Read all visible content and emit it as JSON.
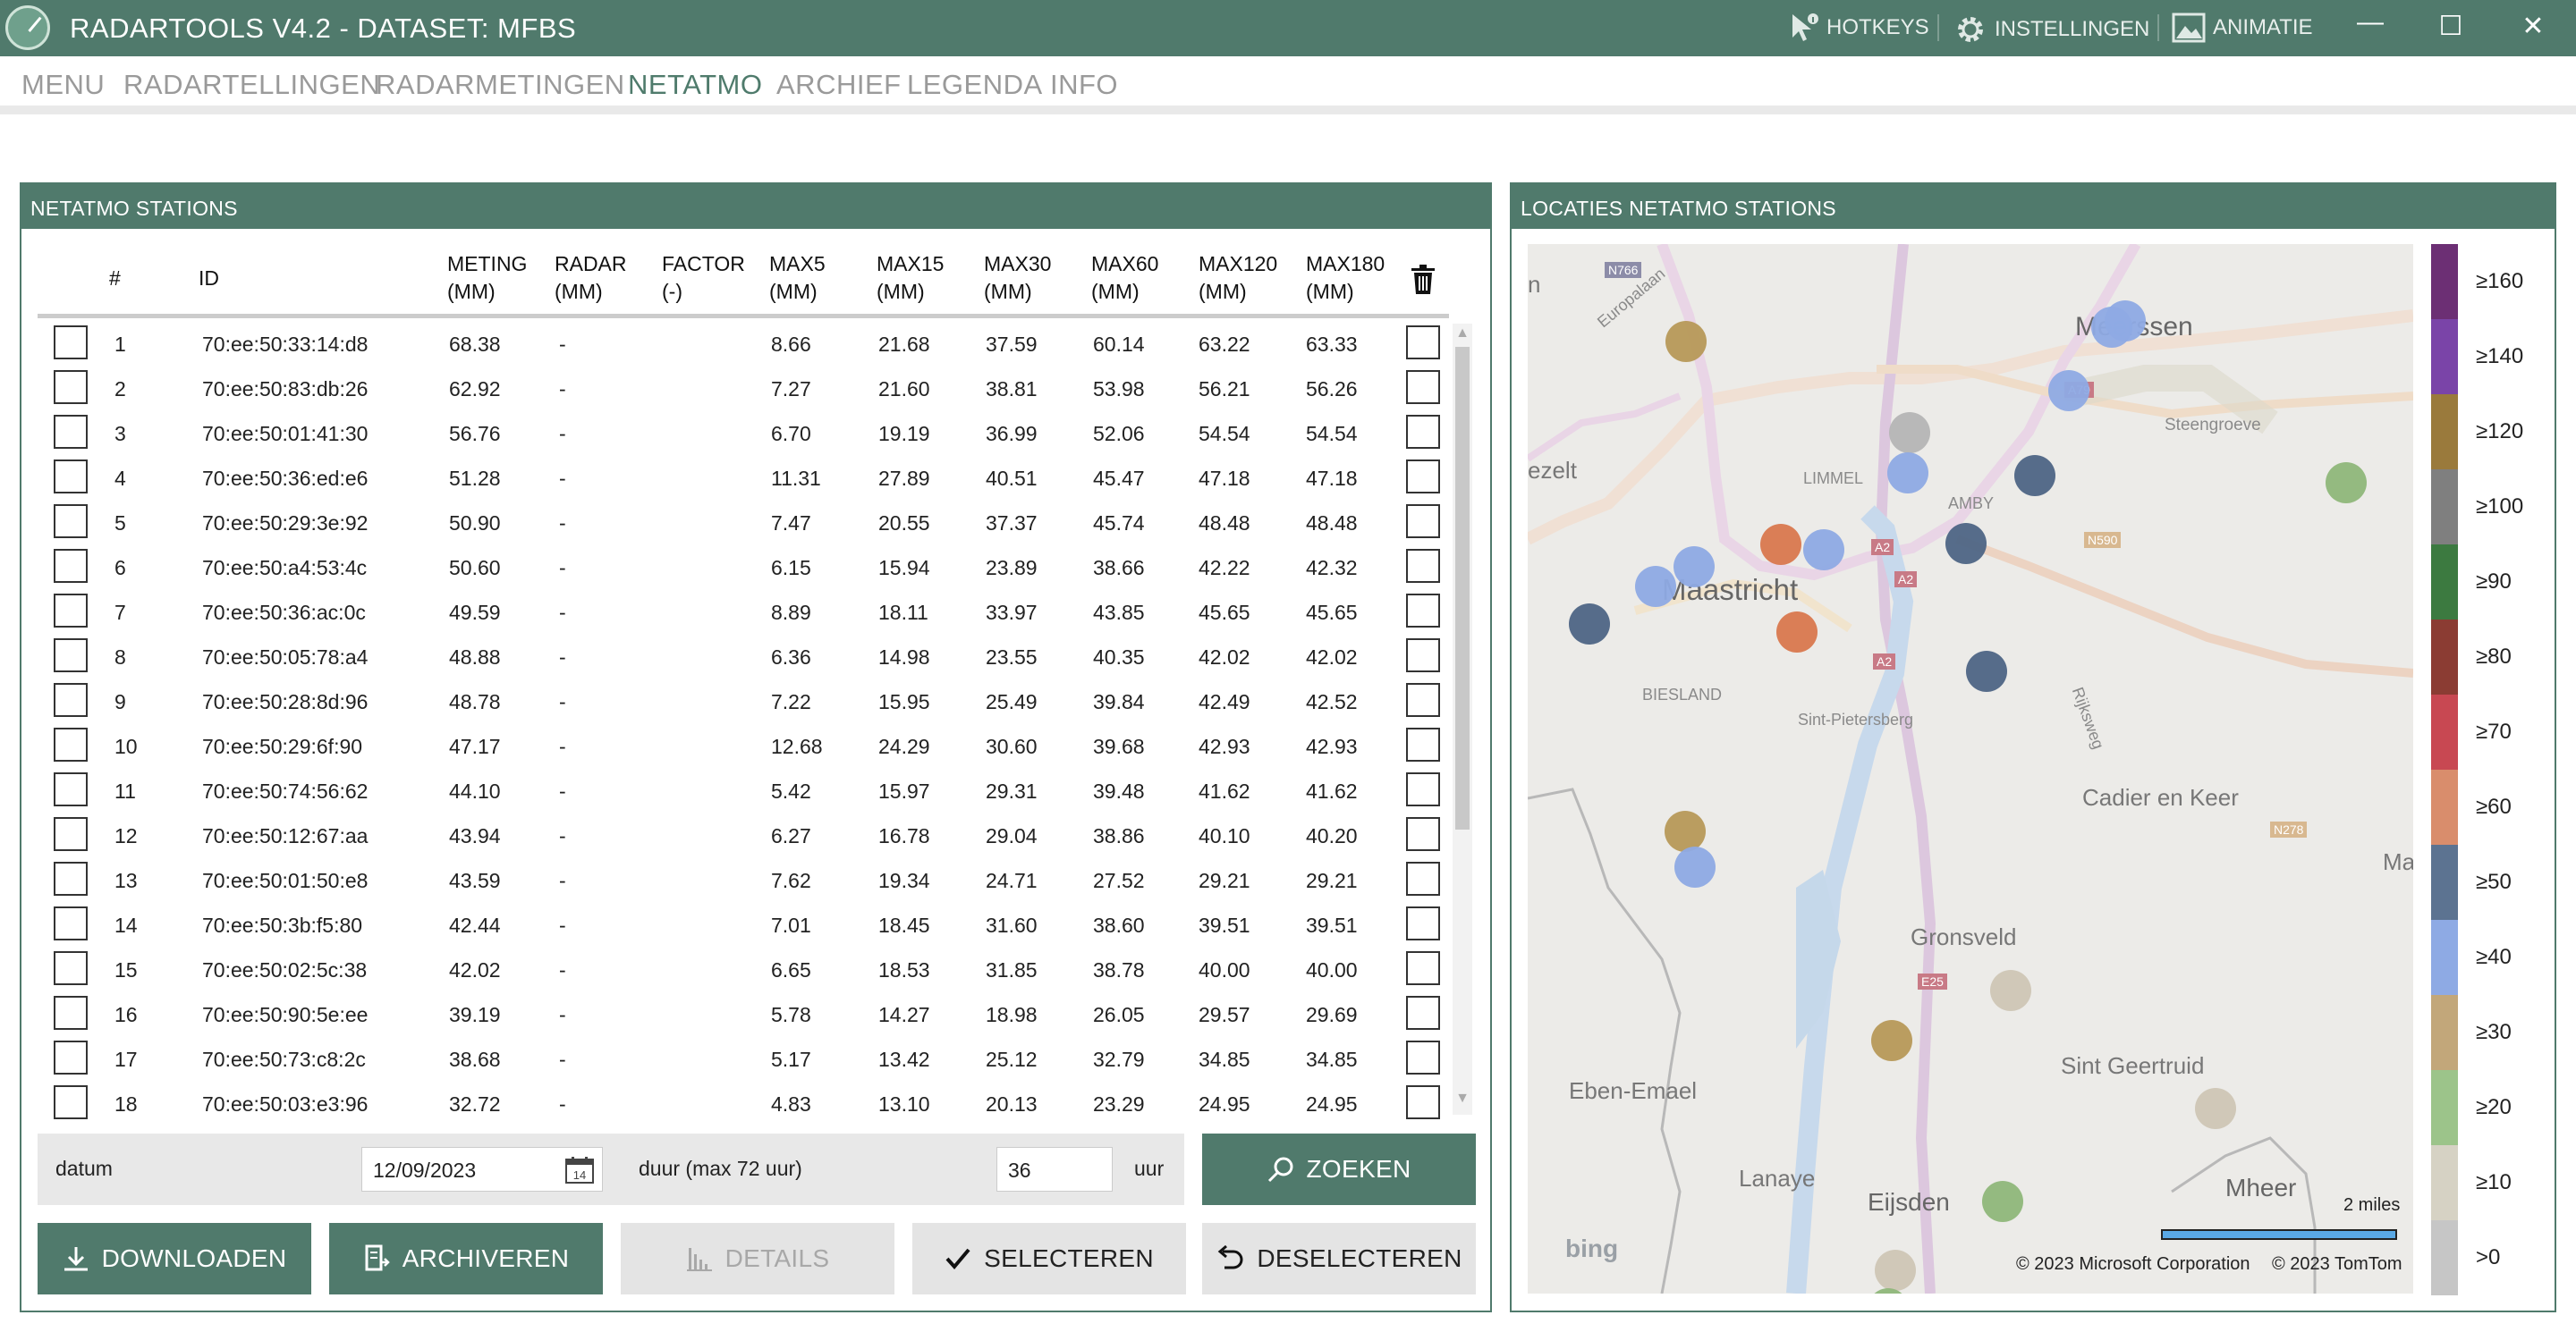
{
  "app": {
    "title": "RADARTOOLS V4.2 - DATASET: MFBS",
    "actions": [
      {
        "label": "HOTKEYS",
        "icon": "cursor-info-icon"
      },
      {
        "label": "INSTELLINGEN",
        "icon": "gear-icon"
      },
      {
        "label": "ANIMATIE",
        "icon": "image-icon"
      }
    ],
    "window": {
      "minimize": "—",
      "maximize": "☐",
      "close": "✕"
    }
  },
  "menu": {
    "items": [
      "MENU",
      "RADARTELLINGEN",
      "RADARMETINGEN",
      "NETATMO",
      "ARCHIEF",
      "LEGENDA",
      "INFO"
    ],
    "active": "NETATMO"
  },
  "stations_panel": {
    "title": "NETATMO STATIONS",
    "columns": {
      "num": "#",
      "id": "ID",
      "meting": [
        "METING",
        "(MM)"
      ],
      "radar": [
        "RADAR",
        "(MM)"
      ],
      "factor": [
        "FACTOR",
        "(-)"
      ],
      "max5": [
        "MAX5",
        "(MM)"
      ],
      "max15": [
        "MAX15",
        "(MM)"
      ],
      "max30": [
        "MAX30",
        "(MM)"
      ],
      "max60": [
        "MAX60",
        "(MM)"
      ],
      "max120": [
        "MAX120",
        "(MM)"
      ],
      "max180": [
        "MAX180",
        "(MM)"
      ]
    },
    "rows": [
      {
        "num": "1",
        "id": "70:ee:50:33:14:d8",
        "meting": "68.38",
        "radar": "-",
        "factor": "",
        "max5": "8.66",
        "max15": "21.68",
        "max30": "37.59",
        "max60": "60.14",
        "max120": "63.22",
        "max180": "63.33"
      },
      {
        "num": "2",
        "id": "70:ee:50:83:db:26",
        "meting": "62.92",
        "radar": "-",
        "factor": "",
        "max5": "7.27",
        "max15": "21.60",
        "max30": "38.81",
        "max60": "53.98",
        "max120": "56.21",
        "max180": "56.26"
      },
      {
        "num": "3",
        "id": "70:ee:50:01:41:30",
        "meting": "56.76",
        "radar": "-",
        "factor": "",
        "max5": "6.70",
        "max15": "19.19",
        "max30": "36.99",
        "max60": "52.06",
        "max120": "54.54",
        "max180": "54.54"
      },
      {
        "num": "4",
        "id": "70:ee:50:36:ed:e6",
        "meting": "51.28",
        "radar": "-",
        "factor": "",
        "max5": "11.31",
        "max15": "27.89",
        "max30": "40.51",
        "max60": "45.47",
        "max120": "47.18",
        "max180": "47.18"
      },
      {
        "num": "5",
        "id": "70:ee:50:29:3e:92",
        "meting": "50.90",
        "radar": "-",
        "factor": "",
        "max5": "7.47",
        "max15": "20.55",
        "max30": "37.37",
        "max60": "45.74",
        "max120": "48.48",
        "max180": "48.48"
      },
      {
        "num": "6",
        "id": "70:ee:50:a4:53:4c",
        "meting": "50.60",
        "radar": "-",
        "factor": "",
        "max5": "6.15",
        "max15": "15.94",
        "max30": "23.89",
        "max60": "38.66",
        "max120": "42.22",
        "max180": "42.32"
      },
      {
        "num": "7",
        "id": "70:ee:50:36:ac:0c",
        "meting": "49.59",
        "radar": "-",
        "factor": "",
        "max5": "8.89",
        "max15": "18.11",
        "max30": "33.97",
        "max60": "43.85",
        "max120": "45.65",
        "max180": "45.65"
      },
      {
        "num": "8",
        "id": "70:ee:50:05:78:a4",
        "meting": "48.88",
        "radar": "-",
        "factor": "",
        "max5": "6.36",
        "max15": "14.98",
        "max30": "23.55",
        "max60": "40.35",
        "max120": "42.02",
        "max180": "42.02"
      },
      {
        "num": "9",
        "id": "70:ee:50:28:8d:96",
        "meting": "48.78",
        "radar": "-",
        "factor": "",
        "max5": "7.22",
        "max15": "15.95",
        "max30": "25.49",
        "max60": "39.84",
        "max120": "42.49",
        "max180": "42.52"
      },
      {
        "num": "10",
        "id": "70:ee:50:29:6f:90",
        "meting": "47.17",
        "radar": "-",
        "factor": "",
        "max5": "12.68",
        "max15": "24.29",
        "max30": "30.60",
        "max60": "39.68",
        "max120": "42.93",
        "max180": "42.93"
      },
      {
        "num": "11",
        "id": "70:ee:50:74:56:62",
        "meting": "44.10",
        "radar": "-",
        "factor": "",
        "max5": "5.42",
        "max15": "15.97",
        "max30": "29.31",
        "max60": "39.48",
        "max120": "41.62",
        "max180": "41.62"
      },
      {
        "num": "12",
        "id": "70:ee:50:12:67:aa",
        "meting": "43.94",
        "radar": "-",
        "factor": "",
        "max5": "6.27",
        "max15": "16.78",
        "max30": "29.04",
        "max60": "38.86",
        "max120": "40.10",
        "max180": "40.20"
      },
      {
        "num": "13",
        "id": "70:ee:50:01:50:e8",
        "meting": "43.59",
        "radar": "-",
        "factor": "",
        "max5": "7.62",
        "max15": "19.34",
        "max30": "24.71",
        "max60": "27.52",
        "max120": "29.21",
        "max180": "29.21"
      },
      {
        "num": "14",
        "id": "70:ee:50:3b:f5:80",
        "meting": "42.44",
        "radar": "-",
        "factor": "",
        "max5": "7.01",
        "max15": "18.45",
        "max30": "31.60",
        "max60": "38.60",
        "max120": "39.51",
        "max180": "39.51"
      },
      {
        "num": "15",
        "id": "70:ee:50:02:5c:38",
        "meting": "42.02",
        "radar": "-",
        "factor": "",
        "max5": "6.65",
        "max15": "18.53",
        "max30": "31.85",
        "max60": "38.78",
        "max120": "40.00",
        "max180": "40.00"
      },
      {
        "num": "16",
        "id": "70:ee:50:90:5e:ee",
        "meting": "39.19",
        "radar": "-",
        "factor": "",
        "max5": "5.78",
        "max15": "14.27",
        "max30": "18.98",
        "max60": "26.05",
        "max120": "29.57",
        "max180": "29.69"
      },
      {
        "num": "17",
        "id": "70:ee:50:73:c8:2c",
        "meting": "38.68",
        "radar": "-",
        "factor": "",
        "max5": "5.17",
        "max15": "13.42",
        "max30": "25.12",
        "max60": "32.79",
        "max120": "34.85",
        "max180": "34.85"
      },
      {
        "num": "18",
        "id": "70:ee:50:03:e3:96",
        "meting": "32.72",
        "radar": "-",
        "factor": "",
        "max5": "4.83",
        "max15": "13.10",
        "max30": "20.13",
        "max60": "23.29",
        "max120": "24.95",
        "max180": "24.95"
      }
    ],
    "filter": {
      "datum_label": "datum",
      "datum_value": "12/09/2023",
      "duur_label": "duur (max 72 uur)",
      "duur_value": "36",
      "unit": "uur",
      "search_label": "ZOEKEN"
    },
    "buttons": {
      "download": "DOWNLOADEN",
      "archive": "ARCHIVEREN",
      "details": "DETAILS",
      "select": "SELECTEREN",
      "deselect": "DESELECTEREN"
    }
  },
  "map_panel": {
    "title": "LOCATIES NETATMO STATIONS",
    "labels": {
      "maastricht": "Maastricht",
      "meerssen": "Meerssen",
      "limmel": "LIMMEL",
      "amby": "AMBY",
      "steengroeve": "Steengroeve",
      "cadier": "Cadier en Keer",
      "gronsveld": "Gronsveld",
      "sint_geertruid": "Sint Geertruid",
      "eben_emael": "Eben-Emael",
      "lanaye": "Lanaye",
      "eijsden": "Eijsden",
      "mheer": "Mheer",
      "biesland": "BIESLAND",
      "sint_pietersberg": "Sint-Pietersberg",
      "europalaan": "Europalaan",
      "rijksweg": "Rijksweg",
      "lanaken_partial": "ezelt",
      "left_partial": "n",
      "right_partial": "Ma",
      "road_n766": "N766",
      "road_a79": "A79",
      "road_n590": "N590",
      "road_a2a": "A2",
      "road_a2b": "A2",
      "road_a2c": "A2",
      "road_n278": "N278",
      "road_e25": "E25"
    },
    "scale_label": "2 miles",
    "attribution": {
      "bing": "bing",
      "microsoft": "© 2023 Microsoft Corporation",
      "tomtom": "© 2023 TomTom"
    },
    "legend": [
      {
        "label": "≥160",
        "color": "#6c2f74"
      },
      {
        "label": "≥140",
        "color": "#7a44a8"
      },
      {
        "label": "≥120",
        "color": "#9a7a3c"
      },
      {
        "label": "≥100",
        "color": "#7f7f7f"
      },
      {
        "label": "≥90",
        "color": "#3c7a40"
      },
      {
        "label": "≥80",
        "color": "#8b3c33"
      },
      {
        "label": "≥70",
        "color": "#c84852"
      },
      {
        "label": "≥60",
        "color": "#d98d6c"
      },
      {
        "label": "≥50",
        "color": "#5c7391"
      },
      {
        "label": "≥40",
        "color": "#8eaae4"
      },
      {
        "label": "≥30",
        "color": "#c2a77a"
      },
      {
        "label": "≥20",
        "color": "#9cc48a"
      },
      {
        "label": "≥10",
        "color": "#d6d2c4"
      },
      {
        "label": ">0",
        "color": "#c6c6c6"
      }
    ],
    "stations": [
      {
        "bucket": "≥30",
        "color": "#b79958"
      },
      {
        "bucket": "≥40",
        "color": "#8eaae4"
      },
      {
        "bucket": "≥40",
        "color": "#8eaae4"
      },
      {
        "bucket": "≥40",
        "color": "#8eaae4"
      },
      {
        "bucket": "≥40",
        "color": "#8eaae4"
      },
      {
        "bucket": ">0",
        "color": "#b5b5b5"
      },
      {
        "bucket": "≥40",
        "color": "#8eaae4"
      },
      {
        "bucket": "≥50",
        "color": "#4e6585"
      },
      {
        "bucket": "≥20",
        "color": "#8fb77a"
      },
      {
        "bucket": "≥60",
        "color": "#d9784e"
      },
      {
        "bucket": "≥50",
        "color": "#4e6585"
      },
      {
        "bucket": "≥40",
        "color": "#8eaae4"
      },
      {
        "bucket": "≥40",
        "color": "#8eaae4"
      },
      {
        "bucket": "≥40",
        "color": "#8eaae4"
      },
      {
        "bucket": "≥60",
        "color": "#d9784e"
      },
      {
        "bucket": "≥50",
        "color": "#4e6585"
      },
      {
        "bucket": "≥50",
        "color": "#4e6585"
      },
      {
        "bucket": ">0",
        "color": "#c0c0c0"
      },
      {
        "bucket": "≥30",
        "color": "#b79958"
      },
      {
        "bucket": "≥40",
        "color": "#8eaae4"
      },
      {
        "bucket": "≥10",
        "color": "#cfc6b5"
      },
      {
        "bucket": "≥30",
        "color": "#b79958"
      },
      {
        "bucket": "≥10",
        "color": "#cfc6b5"
      },
      {
        "bucket": "≥20",
        "color": "#8fb77a"
      },
      {
        "bucket": "≥10",
        "color": "#cfc6b5"
      },
      {
        "bucket": "≥20",
        "color": "#8fb77a"
      }
    ]
  }
}
